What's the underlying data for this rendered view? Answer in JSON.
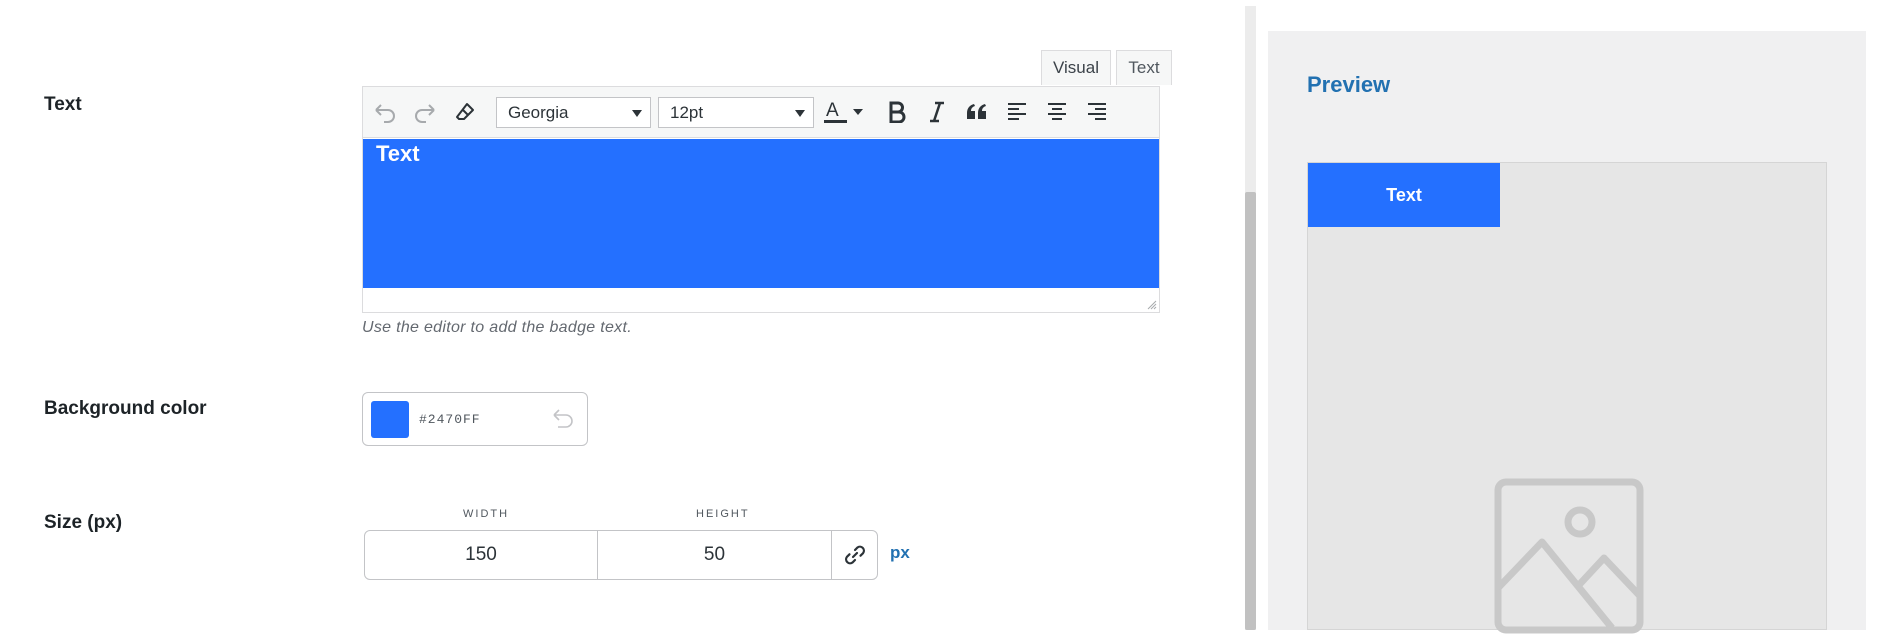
{
  "fields": {
    "text_label": "Text",
    "bg_label": "Background color",
    "size_label": "Size (px)"
  },
  "editor": {
    "tabs": [
      "Visual",
      "Text"
    ],
    "active_tab": "Visual",
    "font_family": "Georgia",
    "font_size": "12pt",
    "content": "Text",
    "help_text": "Use the editor to add the badge text.",
    "toolbar_icons": [
      "undo-icon",
      "redo-icon",
      "clear-formatting-icon",
      "text-color-icon",
      "bold-icon",
      "italic-icon",
      "blockquote-icon",
      "align-left-icon",
      "align-center-icon",
      "align-right-icon"
    ]
  },
  "background": {
    "hex": "#2470FF",
    "color": "#2470ff"
  },
  "size": {
    "width_label": "WIDTH",
    "height_label": "HEIGHT",
    "width": "150",
    "height": "50",
    "unit": "px"
  },
  "preview": {
    "title": "Preview",
    "badge_text": "Text"
  },
  "colors": {
    "accent": "#2271b1",
    "badge": "#2470ff"
  }
}
